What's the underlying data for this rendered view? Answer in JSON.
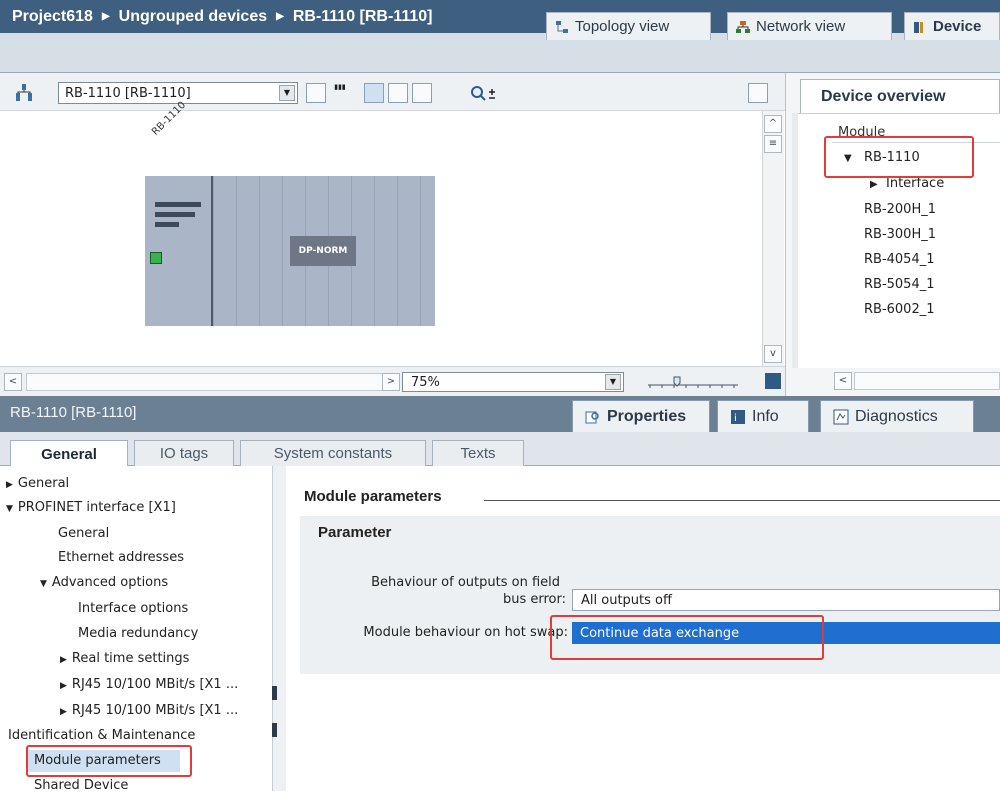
{
  "window": {
    "breadcrumb": [
      "Project618",
      "Ungrouped devices",
      "RB-1110 [RB-1110]"
    ],
    "separator": "▶"
  },
  "view_tabs": [
    {
      "label": "Topology view",
      "icon": "topology-icon"
    },
    {
      "label": "Network view",
      "icon": "network-icon"
    },
    {
      "label": "Device",
      "icon": "device-icon"
    }
  ],
  "toolbar": {
    "device_selected": "RB-1110 [RB-1110]"
  },
  "canvas": {
    "device_label": "RB-1110",
    "module_label": "DP-NORM",
    "zoom": "75%"
  },
  "device_overview": {
    "tab_label": "Device overview",
    "column": "Module",
    "rows": [
      "RB-1110",
      "Interface",
      "RB-200H_1",
      "RB-300H_1",
      "RB-4054_1",
      "RB-5054_1",
      "RB-6002_1"
    ]
  },
  "properties": {
    "title": "RB-1110 [RB-1110]",
    "tabs": [
      {
        "label": "Properties",
        "icon": "properties-icon"
      },
      {
        "label": "Info",
        "icon": "info-icon"
      },
      {
        "label": "Diagnostics",
        "icon": "diagnostics-icon"
      }
    ],
    "subtabs": [
      "General",
      "IO tags",
      "System constants",
      "Texts"
    ]
  },
  "tree": {
    "general": "General",
    "profinet": "PROFINET interface [X1]",
    "pn_general": "General",
    "ethernet": "Ethernet addresses",
    "advanced": "Advanced options",
    "interface_options": "Interface options",
    "media_redundancy": "Media redundancy",
    "realtime": "Real time settings",
    "rj45_a": "RJ45 10/100 MBit/s [X1 ...",
    "rj45_b": "RJ45 10/100 MBit/s [X1 ...",
    "ident": "Identification & Maintenance",
    "module_params": "Module parameters",
    "shared": "Shared Device"
  },
  "module_parameters": {
    "section_title": "Module parameters",
    "parameter_title": "Parameter",
    "outputs_label_line1": "Behaviour of outputs on field",
    "outputs_label_line2": "bus error:",
    "outputs_value": "All outputs off",
    "hotswap_label": "Module behaviour on hot swap:",
    "hotswap_value": "Continue data exchange"
  },
  "colors": {
    "titlebar": "#3e5f7f",
    "selection": "#1f6fd1",
    "highlight_box": "#e23b3b"
  }
}
